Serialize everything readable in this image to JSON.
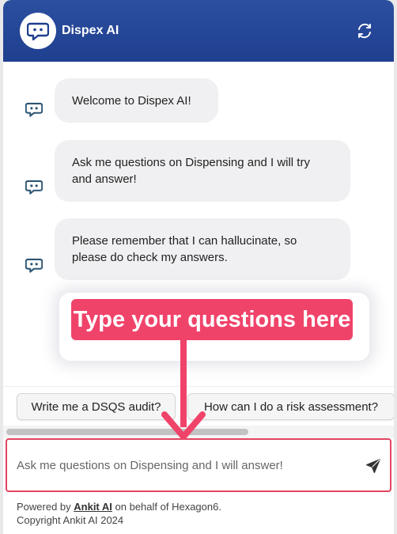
{
  "header": {
    "title": "Dispex AI",
    "logo_icon": "chat-bubble-icon",
    "refresh_icon": "refresh-icon"
  },
  "messages": [
    {
      "lines": [
        "Welcome to Dispex AI!"
      ]
    },
    {
      "lines": [
        "Ask me questions on Dispensing and I will try",
        "and answer!"
      ]
    },
    {
      "lines": [
        "Please remember that I can hallucinate, so",
        "please do check my answers."
      ]
    }
  ],
  "suggestions": [
    "Write me a DSQS audit?",
    "How can I do a risk assessment?"
  ],
  "input": {
    "placeholder": "Ask me questions on Dispensing and I will answer!",
    "send_icon": "send-icon"
  },
  "footer": {
    "powered_prefix": "Powered by ",
    "powered_link": "Ankit AI",
    "powered_suffix": " on behalf of Hexagon6.",
    "copyright": "Copyright Ankit AI 2024"
  },
  "annotation": {
    "text": "Type your questions here",
    "color": "#f0436a"
  },
  "colors": {
    "header": "#2346a0",
    "bubble": "#f0f0f2",
    "icon": "#2c5573"
  }
}
